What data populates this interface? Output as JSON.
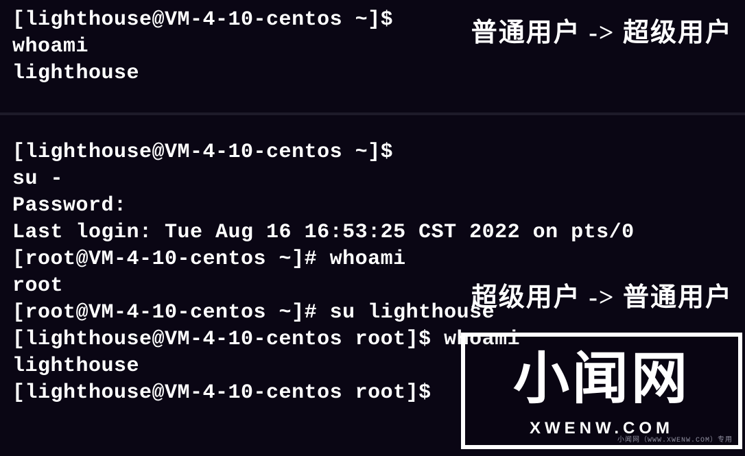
{
  "annotations": {
    "top": "普通用户 -> 超级用户",
    "mid": "超级用户 -> 普通用户"
  },
  "block1": {
    "l1": "[lighthouse@VM-4-10-centos ~]$",
    "l2": "whoami",
    "l3": "lighthouse"
  },
  "block2": {
    "l1": "[lighthouse@VM-4-10-centos ~]$",
    "l2": "su -",
    "l3": "Password:",
    "l4": "Last login: Tue Aug 16 16:53:25 CST 2022 on pts/0",
    "l5": "[root@VM-4-10-centos ~]# whoami",
    "l6": "root",
    "l7": "[root@VM-4-10-centos ~]# su lighthouse",
    "l8": "[lighthouse@VM-4-10-centos root]$ whoami",
    "l9": "lighthouse",
    "l10": "[lighthouse@VM-4-10-centos root]$ "
  },
  "watermark": {
    "big": "小闻网",
    "sub": "XWENW.COM",
    "tiny": "小闻网（WWW.XWENW.COM）专用"
  }
}
